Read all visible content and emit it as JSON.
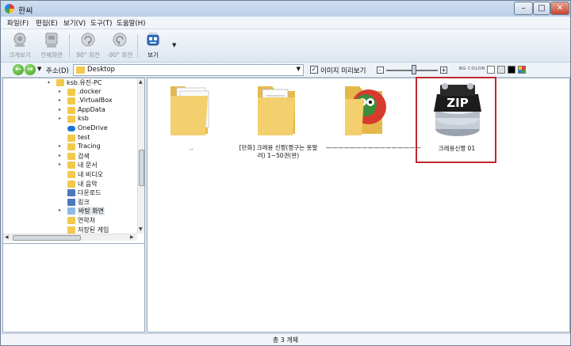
{
  "window": {
    "title": "한씨"
  },
  "menu": [
    "파일(F)",
    "편집(E)",
    "보기(V)",
    "도구(T)",
    "도움말(H)"
  ],
  "toolbar": {
    "items": [
      {
        "label": "크게보기",
        "icon": "enlarge-view-icon"
      },
      {
        "label": "전체화면",
        "icon": "fullscreen-icon"
      },
      {
        "label": "90° 회전",
        "icon": "rotate-right-icon"
      },
      {
        "label": "-90° 회전",
        "icon": "rotate-left-icon"
      },
      {
        "label": "보기",
        "icon": "view-icon"
      }
    ]
  },
  "address": {
    "label": "주소(D)",
    "value": "Desktop",
    "preview_label": "이미지 미리보기",
    "preview_checked": true,
    "bg_color_label": "BG COLOR",
    "bg_colors": [
      "#ffffff",
      "#e0e0e0",
      "#000000",
      "#888888"
    ]
  },
  "tree": [
    {
      "label": "ksb.유진-PC",
      "icon": "folder",
      "indent": 0,
      "expander": "▴"
    },
    {
      "label": ".docker",
      "icon": "folder",
      "indent": 1,
      "expander": "▸"
    },
    {
      "label": ".VirtualBox",
      "icon": "folder",
      "indent": 1,
      "expander": "▸"
    },
    {
      "label": "AppData",
      "icon": "folder",
      "indent": 1,
      "expander": "▸"
    },
    {
      "label": "ksb",
      "icon": "folder",
      "indent": 1,
      "expander": "▸"
    },
    {
      "label": "OneDrive",
      "icon": "cloud",
      "indent": 1,
      "expander": ""
    },
    {
      "label": "test",
      "icon": "folder",
      "indent": 1,
      "expander": ""
    },
    {
      "label": "Tracing",
      "icon": "folder",
      "indent": 1,
      "expander": "▸"
    },
    {
      "label": "검색",
      "icon": "folder",
      "indent": 1,
      "expander": "▸"
    },
    {
      "label": "내 문서",
      "icon": "folder",
      "indent": 1,
      "expander": "▸"
    },
    {
      "label": "내 비디오",
      "icon": "folder",
      "indent": 1,
      "expander": ""
    },
    {
      "label": "내 음악",
      "icon": "folder",
      "indent": 1,
      "expander": ""
    },
    {
      "label": "다운로드",
      "icon": "blue",
      "indent": 1,
      "expander": ""
    },
    {
      "label": "링크",
      "icon": "blue",
      "indent": 1,
      "expander": ""
    },
    {
      "label": "바탕 화면",
      "icon": "lt",
      "indent": 1,
      "expander": "▸",
      "selected": true
    },
    {
      "label": "연락처",
      "icon": "folder",
      "indent": 1,
      "expander": ""
    },
    {
      "label": "저장된 게임",
      "icon": "folder",
      "indent": 1,
      "expander": ""
    }
  ],
  "items": [
    {
      "caption": "..",
      "kind": "folder-up"
    },
    {
      "caption": "[만화] 크레용 신짱(짱구는 못말려) 1~50권(완)",
      "kind": "folder-docs"
    },
    {
      "caption": "————————————————",
      "kind": "folder-image"
    },
    {
      "caption": "크레용신짱 01",
      "kind": "zip",
      "zip_text": "ZIP",
      "selected": true
    }
  ],
  "status": {
    "text": "총 3 개체"
  }
}
